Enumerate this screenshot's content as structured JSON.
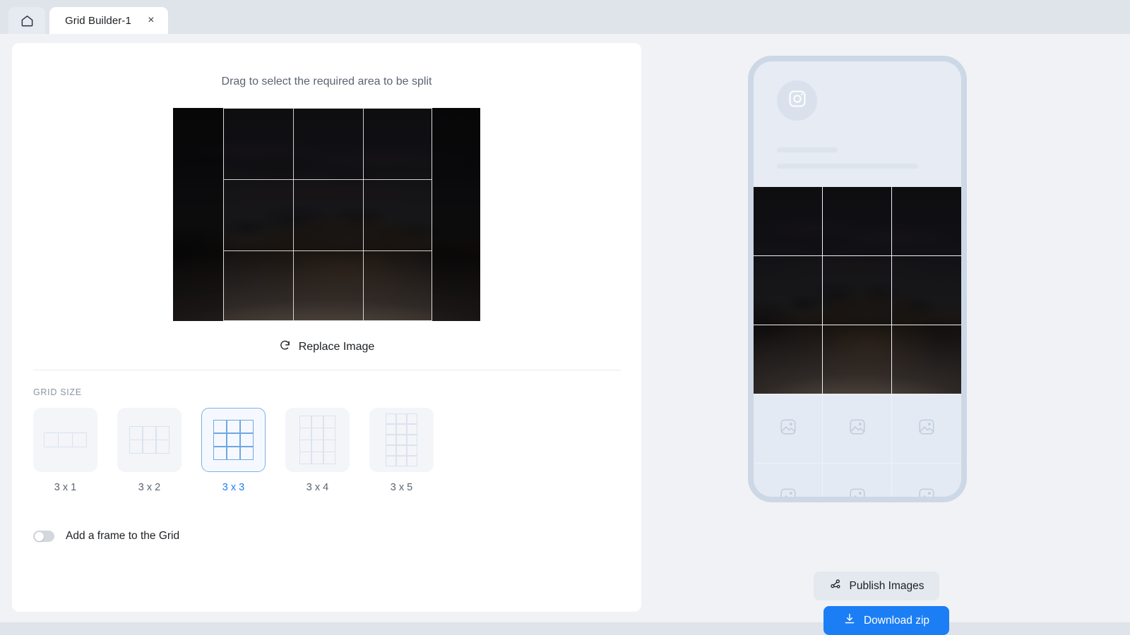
{
  "tabbar": {
    "home_icon": "home-icon",
    "tab_title": "Grid Builder-1",
    "close_label": "×"
  },
  "editor": {
    "drag_hint": "Drag to select the required area to be split",
    "replace_label": "Replace Image",
    "replace_icon": "refresh-icon",
    "grid_size_label": "GRID SIZE",
    "frame_toggle_label": "Add a frame to the Grid",
    "frame_toggle_on": false,
    "selection": {
      "columns": 3,
      "rows": 3
    }
  },
  "grid_options": [
    {
      "label": "3 x 1",
      "cols": 3,
      "rows": 1,
      "cell": 20,
      "selected": false
    },
    {
      "label": "3 x 2",
      "cols": 3,
      "rows": 2,
      "cell": 19,
      "selected": false
    },
    {
      "label": "3 x 3",
      "cols": 3,
      "rows": 3,
      "cell": 19,
      "selected": true
    },
    {
      "label": "3 x 4",
      "cols": 3,
      "rows": 4,
      "cell": 17,
      "selected": false
    },
    {
      "label": "3 x 5",
      "cols": 3,
      "rows": 5,
      "cell": 15,
      "selected": false
    }
  ],
  "preview": {
    "avatar_icon": "instagram-icon",
    "placeholder_icon": "image-placeholder-icon",
    "filled_cells": 9,
    "total_cells": 15
  },
  "actions": {
    "publish_label": "Publish Images",
    "publish_icon": "share-nodes-icon",
    "download_label": "Download zip",
    "download_icon": "download-icon"
  },
  "colors": {
    "accent": "#1b7ef5",
    "page_bg": "#f1f2f5",
    "tabbar_bg": "#dfe3ea",
    "card_bg": "#ffffff",
    "phone_frame": "#cdd8e6"
  }
}
